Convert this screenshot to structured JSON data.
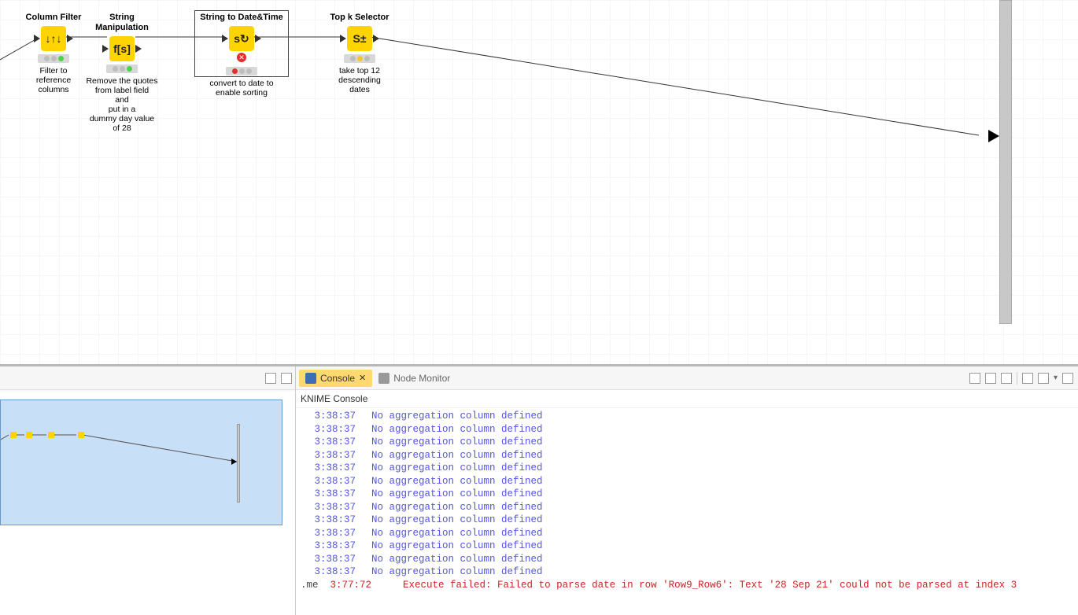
{
  "nodes": [
    {
      "title": "Column Filter",
      "desc": "Filter to\nreference\ncolumns",
      "status": "green"
    },
    {
      "title": "String Manipulation",
      "desc": "Remove the quotes\nfrom label field\nand\nput in a\ndummy day value\nof 28",
      "status": "green"
    },
    {
      "title": "String to Date&Time",
      "desc": "convert to date to enable sorting",
      "status": "error"
    },
    {
      "title": "Top k Selector",
      "desc": "take top 12 descending\ndates",
      "status": "yellow"
    }
  ],
  "glyphs": [
    "↓↑↓",
    "f[s]",
    "s↻",
    "S±"
  ],
  "tabs": {
    "console": "Console",
    "node_monitor": "Node Monitor"
  },
  "console_title": "KNIME Console",
  "logs": [
    {
      "ts": "3:38:37",
      "msg": "No aggregation column defined"
    },
    {
      "ts": "3:38:37",
      "msg": "No aggregation column defined"
    },
    {
      "ts": "3:38:37",
      "msg": "No aggregation column defined"
    },
    {
      "ts": "3:38:37",
      "msg": "No aggregation column defined"
    },
    {
      "ts": "3:38:37",
      "msg": "No aggregation column defined"
    },
    {
      "ts": "3:38:37",
      "msg": "No aggregation column defined"
    },
    {
      "ts": "3:38:37",
      "msg": "No aggregation column defined"
    },
    {
      "ts": "3:38:37",
      "msg": "No aggregation column defined"
    },
    {
      "ts": "3:38:37",
      "msg": "No aggregation column defined"
    },
    {
      "ts": "3:38:37",
      "msg": "No aggregation column defined"
    },
    {
      "ts": "3:38:37",
      "msg": "No aggregation column defined"
    },
    {
      "ts": "3:38:37",
      "msg": "No aggregation column defined"
    },
    {
      "ts": "3:38:37",
      "msg": "No aggregation column defined"
    }
  ],
  "error": {
    "prefix": ".me",
    "ts": "3:77:72",
    "msg": "Execute failed: Failed to parse date in row 'Row9_Row6': Text '28 Sep 21' could not be parsed at index 3"
  }
}
